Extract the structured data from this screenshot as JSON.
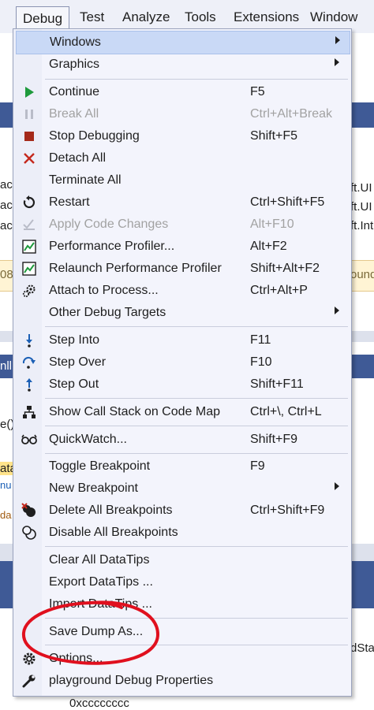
{
  "menubar": {
    "items": [
      "Debug",
      "Test",
      "Analyze",
      "Tools",
      "Extensions",
      "Window"
    ]
  },
  "background": {
    "left_fragments": [
      "ac",
      "ac",
      "ac",
      "08",
      "nll",
      "e()",
      "ata",
      "nu",
      "da"
    ],
    "right_fragments": [
      "ft.UI",
      "ft.UI",
      "ft.Int",
      "ound",
      "dSta"
    ],
    "below_menu": "0xcccccccc"
  },
  "menu": {
    "windows": "Windows",
    "graphics": "Graphics",
    "continue": "Continue",
    "continue_sc": "F5",
    "break_all": "Break All",
    "break_all_sc": "Ctrl+Alt+Break",
    "stop_debugging": "Stop Debugging",
    "stop_debugging_sc": "Shift+F5",
    "detach_all": "Detach All",
    "terminate_all": "Terminate All",
    "restart": "Restart",
    "restart_sc": "Ctrl+Shift+F5",
    "apply_code_changes": "Apply Code Changes",
    "apply_code_changes_sc": "Alt+F10",
    "performance_profiler": "Performance Profiler...",
    "performance_profiler_sc": "Alt+F2",
    "relaunch_profiler": "Relaunch Performance Profiler",
    "relaunch_profiler_sc": "Shift+Alt+F2",
    "attach_to_process": "Attach to Process...",
    "attach_to_process_sc": "Ctrl+Alt+P",
    "other_debug_targets": "Other Debug Targets",
    "step_into": "Step Into",
    "step_into_sc": "F11",
    "step_over": "Step Over",
    "step_over_sc": "F10",
    "step_out": "Step Out",
    "step_out_sc": "Shift+F11",
    "show_call_stack": "Show Call Stack on Code Map",
    "show_call_stack_sc": "Ctrl+\\, Ctrl+L",
    "quickwatch": "QuickWatch...",
    "quickwatch_sc": "Shift+F9",
    "toggle_breakpoint": "Toggle Breakpoint",
    "toggle_breakpoint_sc": "F9",
    "new_breakpoint": "New Breakpoint",
    "delete_all_breakpoints": "Delete All Breakpoints",
    "delete_all_breakpoints_sc": "Ctrl+Shift+F9",
    "disable_all_breakpoints": "Disable All Breakpoints",
    "clear_all_datatips": "Clear All DataTips",
    "export_datatips": "Export DataTips ...",
    "import_datatips": "Import DataTips ...",
    "save_dump_as": "Save Dump As...",
    "options": "Options...",
    "debug_properties": "playground Debug Properties"
  },
  "colors": {
    "continue_green": "#1e9a3c",
    "stop_red": "#a52a1a",
    "step_blue": "#1b5fb5",
    "annotation_red": "#e0101e"
  }
}
